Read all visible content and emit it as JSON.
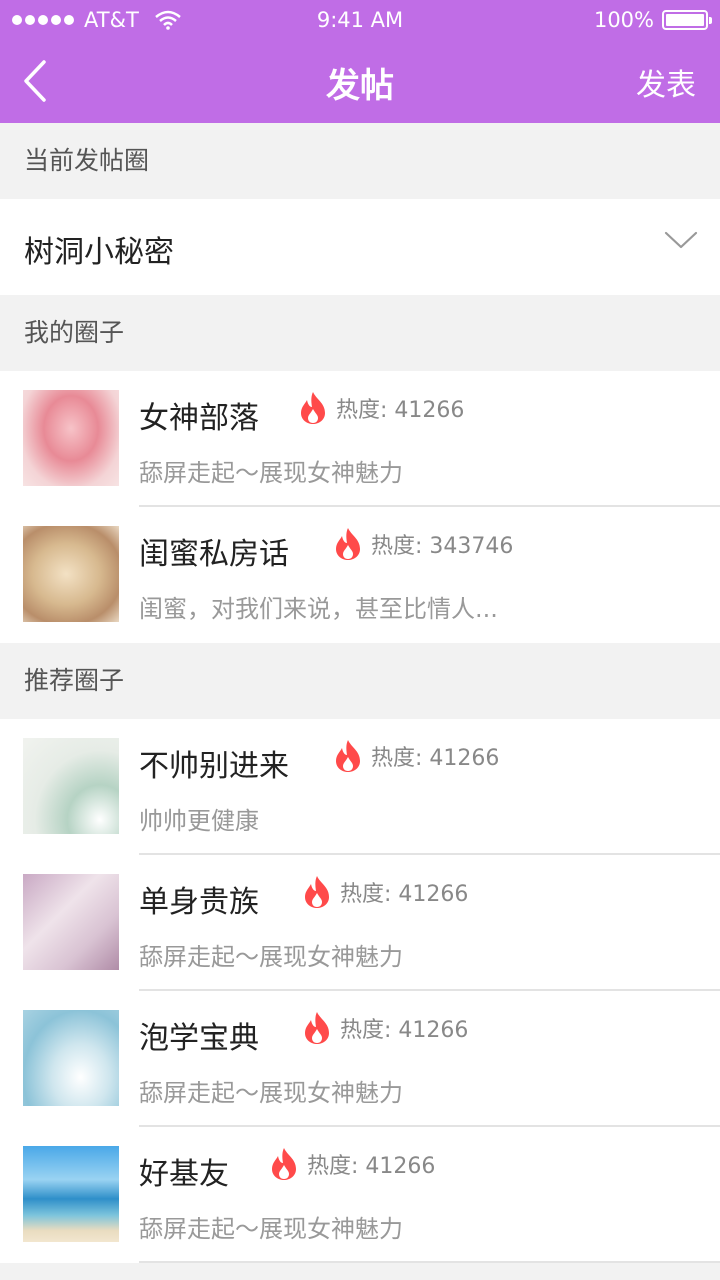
{
  "status_bar": {
    "carrier": "AT&T",
    "time": "9:41 AM",
    "battery": "100%"
  },
  "nav": {
    "title": "发帖",
    "publish_label": "发表",
    "back_icon": "chevron-left-icon"
  },
  "current": {
    "header": "当前发帖圈",
    "selected": "树洞小秘密"
  },
  "my_circles": {
    "header": "我的圈子",
    "items": [
      {
        "name": "女神部落",
        "heat": "热度: 41266",
        "desc": "舔屏走起～展现女神魅力"
      },
      {
        "name": "闺蜜私房话",
        "heat": "热度: 343746",
        "desc": "闺蜜，对我们来说，甚至比情人..."
      }
    ]
  },
  "recommended": {
    "header": "推荐圈子",
    "items": [
      {
        "name": "不帅别进来",
        "heat": "热度: 41266",
        "desc": "帅帅更健康"
      },
      {
        "name": "单身贵族",
        "heat": "热度: 41266",
        "desc": "舔屏走起～展现女神魅力"
      },
      {
        "name": "泡学宝典",
        "heat": "热度: 41266",
        "desc": "舔屏走起～展现女神魅力"
      },
      {
        "name": "好基友",
        "heat": "热度: 41266",
        "desc": "舔屏走起～展现女神魅力"
      }
    ]
  },
  "colors": {
    "accent": "#c06de6",
    "flame": "#ff4a4a"
  }
}
